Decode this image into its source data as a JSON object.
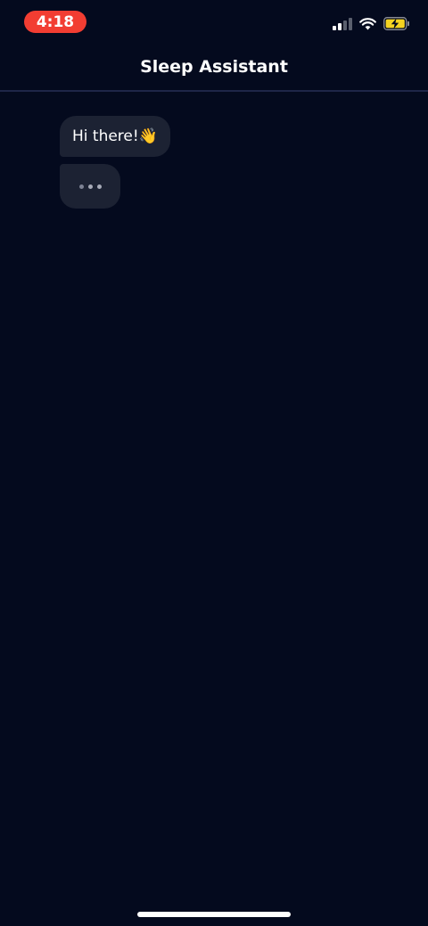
{
  "status_bar": {
    "time": "4:18",
    "time_pill_color": "#f23d32",
    "icons": [
      "cellular-signal-icon",
      "wifi-icon",
      "battery-charging-icon"
    ],
    "battery_color": "#f5d321"
  },
  "header": {
    "title": "Sleep Assistant"
  },
  "chat": {
    "messages": [
      {
        "from": "assistant",
        "text": "Hi there!👋"
      }
    ],
    "typing_indicator": true
  },
  "colors": {
    "background": "#040a1e",
    "bubble": "#1c2233",
    "divider": "#1e2648"
  }
}
